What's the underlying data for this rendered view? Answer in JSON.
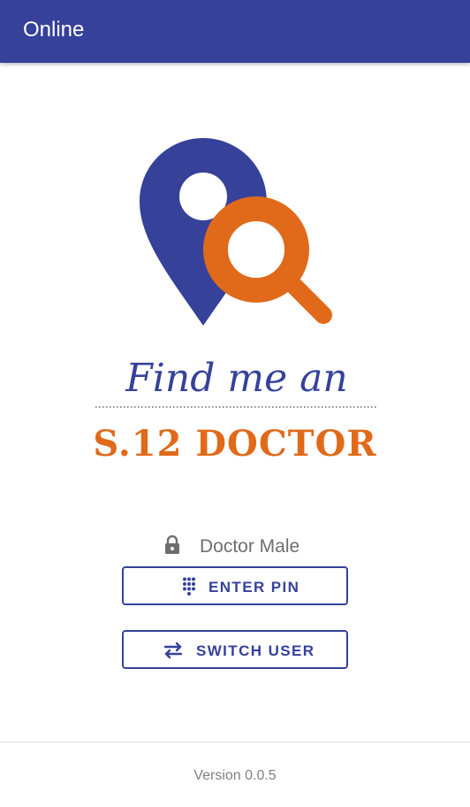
{
  "appbar": {
    "title": "Online"
  },
  "logo": {
    "tagline": "Find me an",
    "brand": "S.12 DOCTOR",
    "colors": {
      "blue": "#36419a",
      "orange": "#e06a1a"
    }
  },
  "user": {
    "name": "Doctor Male",
    "icon": "lock-icon"
  },
  "buttons": {
    "enter_pin": {
      "label": "ENTER PIN",
      "icon": "dialpad-icon"
    },
    "switch_user": {
      "label": "SWITCH USER",
      "icon": "swap-icon"
    }
  },
  "footer": {
    "version": "Version 0.0.5"
  },
  "theme": {
    "primary": "#36419a",
    "accent": "#e06a1a"
  }
}
